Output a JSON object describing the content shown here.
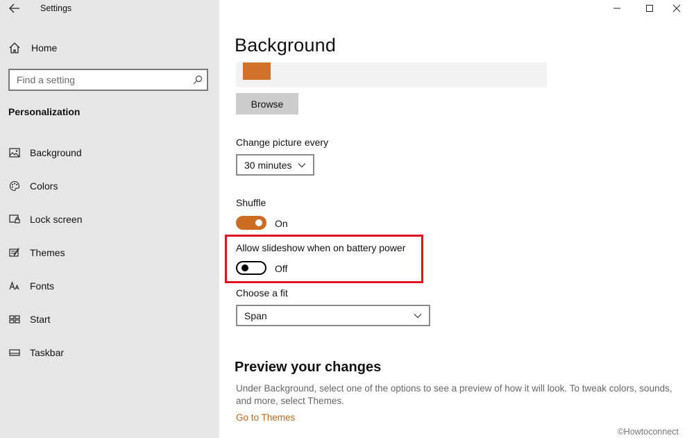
{
  "window": {
    "title": "Settings",
    "controls": {
      "minimize": "minimize",
      "maximize": "maximize",
      "close": "close"
    }
  },
  "sidebar": {
    "home_label": "Home",
    "search": {
      "placeholder": "Find a setting"
    },
    "section_title": "Personalization",
    "items": [
      {
        "label": "Background",
        "icon": "image-icon"
      },
      {
        "label": "Colors",
        "icon": "palette-icon"
      },
      {
        "label": "Lock screen",
        "icon": "lock-screen-icon"
      },
      {
        "label": "Themes",
        "icon": "themes-icon"
      },
      {
        "label": "Fonts",
        "icon": "fonts-icon"
      },
      {
        "label": "Start",
        "icon": "start-icon"
      },
      {
        "label": "Taskbar",
        "icon": "taskbar-icon"
      }
    ]
  },
  "main": {
    "page_title": "Background",
    "browse_label": "Browse",
    "change_picture": {
      "label": "Change picture every",
      "value": "30 minutes"
    },
    "shuffle": {
      "label": "Shuffle",
      "state": "On"
    },
    "battery": {
      "label": "Allow slideshow when on battery power",
      "state": "Off"
    },
    "fit": {
      "label": "Choose a fit",
      "value": "Span"
    },
    "preview": {
      "title": "Preview your changes",
      "description": "Under Background, select one of the options to see a preview of how it will look. To tweak colors, sounds, and more, select Themes.",
      "link": "Go to Themes"
    }
  },
  "watermark": "©Howtoconnect",
  "colors": {
    "accent": "#cc6b22",
    "highlight": "#e0141e",
    "sidebar_bg": "#e6e6e6"
  }
}
